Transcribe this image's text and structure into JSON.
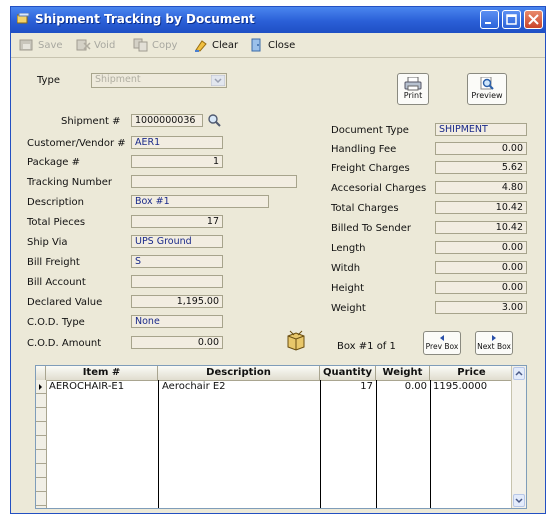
{
  "window": {
    "title": "Shipment Tracking by Document"
  },
  "toolbar": {
    "save": "Save",
    "void": "Void",
    "copy": "Copy",
    "clear": "Clear",
    "close": "Close"
  },
  "form": {
    "type_label": "Type",
    "type_value": "Shipment",
    "shipment_label": "Shipment #",
    "shipment_value": "1000000036",
    "customer_label": "Customer/Vendor #",
    "customer_value": "AER1",
    "package_label": "Package #",
    "package_value": "1",
    "tracking_label": "Tracking Number",
    "tracking_value": "",
    "description_label": "Description",
    "description_value": "Box #1",
    "total_pieces_label": "Total Pieces",
    "total_pieces_value": "17",
    "ship_via_label": "Ship Via",
    "ship_via_value": "UPS Ground",
    "bill_freight_label": "Bill Freight",
    "bill_freight_value": "S",
    "bill_account_label": "Bill Account",
    "bill_account_value": "",
    "declared_label": "Declared Value",
    "declared_value": "1,195.00",
    "cod_type_label": "C.O.D. Type",
    "cod_type_value": "None",
    "cod_amount_label": "C.O.D. Amount",
    "cod_amount_value": "0.00"
  },
  "right": {
    "print_label": "Print",
    "preview_label": "Preview",
    "doc_type_label": "Document Type",
    "doc_type_value": "SHIPMENT",
    "handling_label": "Handling Fee",
    "handling_value": "0.00",
    "freight_label": "Freight Charges",
    "freight_value": "5.62",
    "access_label": "Accesorial Charges",
    "access_value": "4.80",
    "total_label": "Total Charges",
    "total_value": "10.42",
    "billed_label": "Billed To Sender",
    "billed_value": "10.42",
    "length_label": "Length",
    "length_value": "0.00",
    "width_label": "Witdh",
    "width_value": "0.00",
    "height_label": "Height",
    "height_value": "0.00",
    "weight_label": "Weight",
    "weight_value": "3.00",
    "box_of": "Box #1 of 1",
    "prev_box": "Prev Box",
    "next_box": "Next Box"
  },
  "grid": {
    "columns": [
      "Item #",
      "Description",
      "Quantity",
      "Weight",
      "Price"
    ],
    "rows": [
      {
        "item": "AEROCHAIR-E1",
        "description": "Aerochair E2",
        "quantity": "17",
        "weight": "0.00",
        "price": "1195.0000"
      }
    ]
  }
}
